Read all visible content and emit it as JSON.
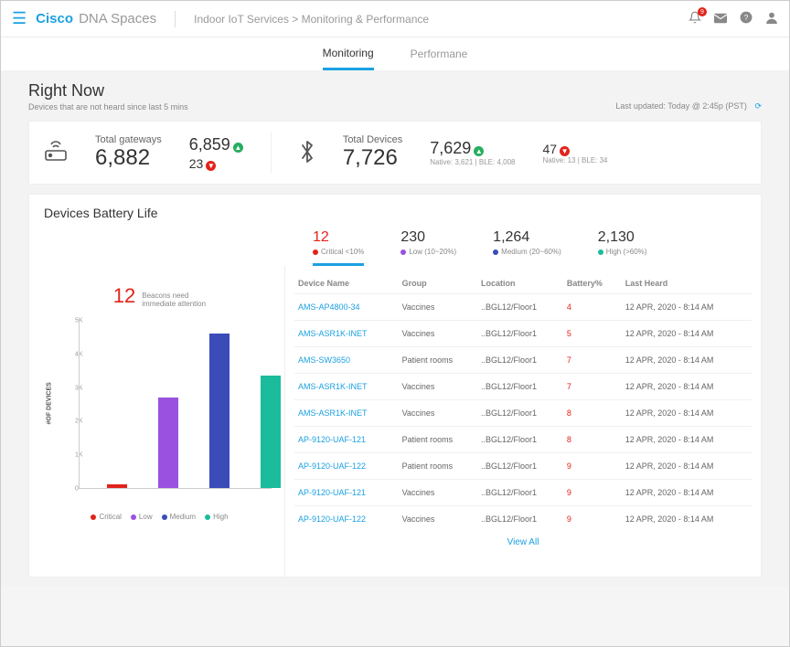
{
  "header": {
    "brand1": "Cisco",
    "brand2": "DNA Spaces",
    "breadcrumb_parent": "Indoor IoT Services",
    "breadcrumb_sep": ">",
    "breadcrumb_current": "Monitoring & Performance",
    "badge_count": "9"
  },
  "tabs": [
    "Monitoring",
    "Performane"
  ],
  "rightnow": {
    "title": "Right Now",
    "subtitle": "Devices that are not heard since last 5 mins",
    "updated": "Last updated: Today @ 2:45p (PST)",
    "gateways": {
      "label": "Total gateways",
      "value": "6,882"
    },
    "gw_up": "6,859",
    "gw_down": "23",
    "devices": {
      "label": "Total Devices",
      "value": "7,726"
    },
    "dev_up": "7,629",
    "dev_up_sub": "Native: 3,621  |  BLE: 4,008",
    "dev_down": "47",
    "dev_down_sub": "Native: 13  |  BLE: 34"
  },
  "battery": {
    "title": "Devices Battery Life",
    "metrics": [
      {
        "value": "12",
        "label": "Critical <10%",
        "dot": "d-red",
        "red": true,
        "active": true
      },
      {
        "value": "230",
        "label": "Low (10~20%)",
        "dot": "d-purple"
      },
      {
        "value": "1,264",
        "label": "Medium (20~60%)",
        "dot": "d-blue"
      },
      {
        "value": "2,130",
        "label": "High (>60%)",
        "dot": "d-teal"
      }
    ],
    "alert_num": "12",
    "alert_txt": "Beacons need immediate attention",
    "legend": [
      "Critical",
      "Low",
      "Medium",
      "High"
    ],
    "yaxis_label": "#OF DEVICES",
    "view_all": "View All"
  },
  "chart_data": {
    "type": "bar",
    "categories": [
      "Critical",
      "Low",
      "Medium",
      "High"
    ],
    "values": [
      100,
      2700,
      4600,
      3350
    ],
    "colors": [
      "#e2231a",
      "#9b51e0",
      "#3b4bb8",
      "#1abc9c"
    ],
    "ylim": [
      0,
      5000
    ],
    "yticks": [
      0,
      1000,
      2000,
      3000,
      4000,
      5000
    ],
    "ytick_labels": [
      "0",
      "1K",
      "2K",
      "3K",
      "4K",
      "5K"
    ],
    "xlabel": "",
    "ylabel": "#OF DEVICES",
    "title": ""
  },
  "table": {
    "cols": [
      "Device Name",
      "Group",
      "Location",
      "Battery%",
      "Last Heard"
    ],
    "rows": [
      {
        "name": "AMS-AP4800-34",
        "group": "Vaccines",
        "loc": "..BGL12/Floor1",
        "batt": "4",
        "heard": "12 APR, 2020 - 8:14 AM"
      },
      {
        "name": "AMS-ASR1K-INET",
        "group": "Vaccines",
        "loc": "..BGL12/Floor1",
        "batt": "5",
        "heard": "12 APR, 2020 - 8:14 AM"
      },
      {
        "name": "AMS-SW3650",
        "group": "Patient rooms",
        "loc": "..BGL12/Floor1",
        "batt": "7",
        "heard": "12 APR, 2020 - 8:14 AM"
      },
      {
        "name": "AMS-ASR1K-INET",
        "group": "Vaccines",
        "loc": "..BGL12/Floor1",
        "batt": "7",
        "heard": "12 APR, 2020 - 8:14 AM"
      },
      {
        "name": "AMS-ASR1K-INET",
        "group": "Vaccines",
        "loc": "..BGL12/Floor1",
        "batt": "8",
        "heard": "12 APR, 2020 - 8:14 AM"
      },
      {
        "name": "AP-9120-UAF-121",
        "group": "Patient rooms",
        "loc": "..BGL12/Floor1",
        "batt": "8",
        "heard": "12 APR, 2020 - 8:14 AM"
      },
      {
        "name": "AP-9120-UAF-122",
        "group": "Patient rooms",
        "loc": "..BGL12/Floor1",
        "batt": "9",
        "heard": "12 APR, 2020 - 8:14 AM"
      },
      {
        "name": "AP-9120-UAF-121",
        "group": "Vaccines",
        "loc": "..BGL12/Floor1",
        "batt": "9",
        "heard": "12 APR, 2020 - 8:14 AM"
      },
      {
        "name": "AP-9120-UAF-122",
        "group": "Vaccines",
        "loc": "..BGL12/Floor1",
        "batt": "9",
        "heard": "12 APR, 2020 - 8:14 AM"
      }
    ]
  }
}
